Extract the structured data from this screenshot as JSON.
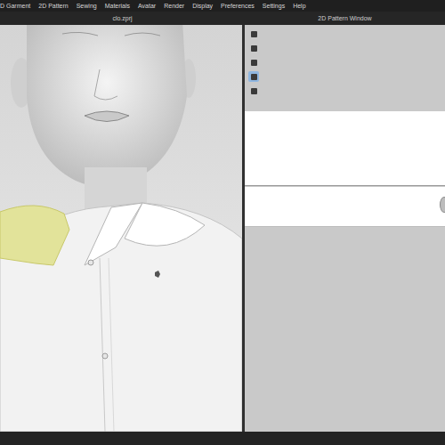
{
  "menu": [
    "D Garment",
    "2D Pattern",
    "Sewing",
    "Materials",
    "Avatar",
    "Render",
    "Display",
    "Preferences",
    "Settings",
    "Help"
  ],
  "viewport": {
    "title": "clo.zprj"
  },
  "pattern_window": {
    "title": "2D Pattern Window",
    "tools": [
      {
        "selected": false
      },
      {
        "selected": false
      },
      {
        "selected": false
      },
      {
        "selected": true
      },
      {
        "selected": false
      }
    ]
  }
}
